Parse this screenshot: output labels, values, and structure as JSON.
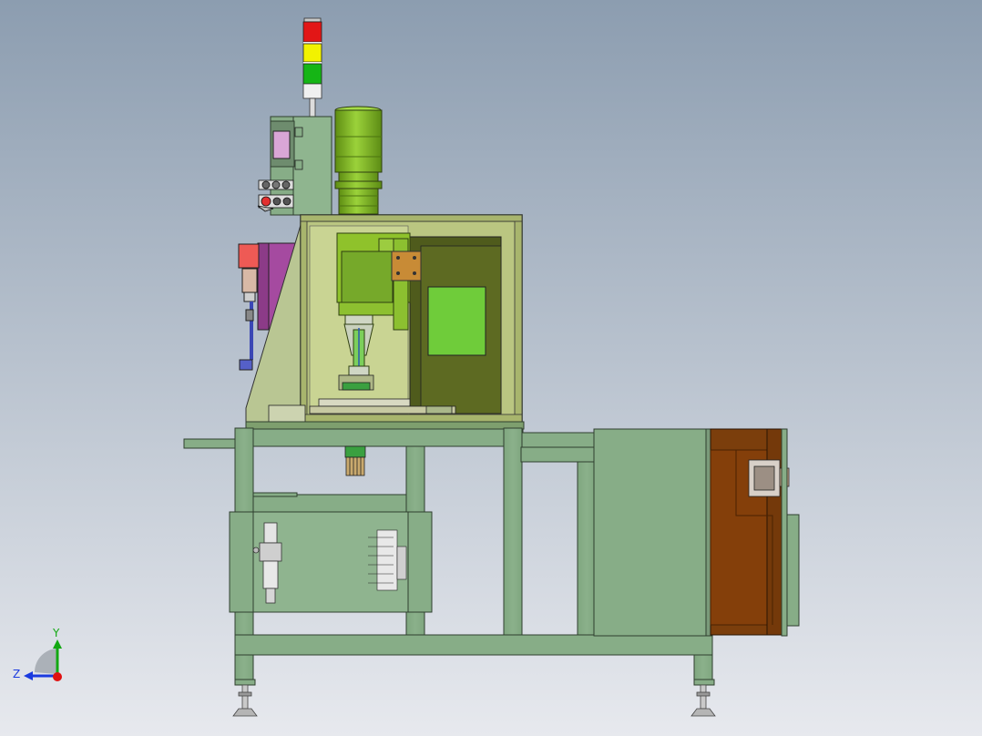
{
  "triad": {
    "y_label": "Y",
    "z_label": "Z"
  },
  "colors": {
    "background_top": "#8fa0b3",
    "background_bottom": "#e6e8ee",
    "frame_green": "#86ac86",
    "frame_outline": "#2f3f2f",
    "enclosure_yellow": "#c2cd8a",
    "spindle_green": "#8fc22b",
    "dark_olive": "#4e5a1a",
    "panel_green": "#6fcc3a",
    "brown_door": "#7b3e0c",
    "magenta": "#a54aa0",
    "salmon": "#e85a55",
    "lamp_red": "#e21616",
    "lamp_yellow": "#f2f200",
    "lamp_green": "#15b515",
    "axis_blue": "#1a3adf",
    "axis_green": "#12a812",
    "axis_red": "#e01010"
  },
  "components": [
    "signal-tower",
    "control-panel",
    "spindle-motor",
    "safety-enclosure",
    "machine-frame",
    "electrical-cabinet",
    "side-door",
    "leveling-feet",
    "coordinate-triad"
  ]
}
